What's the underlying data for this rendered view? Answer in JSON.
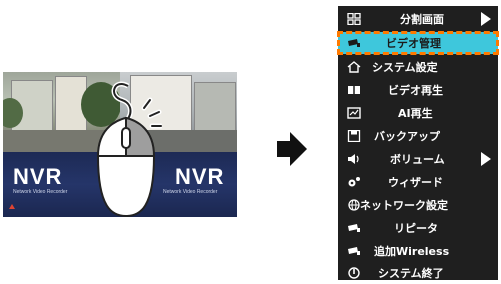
{
  "nvr_screen": {
    "logo_left": "NVR",
    "logo_right": "NVR",
    "subtitle_left": "Network Video Recorder",
    "subtitle_right": "Network Video Recorder"
  },
  "menu": {
    "items": [
      {
        "label": "分割画面",
        "icon": "grid-icon",
        "has_submenu": true
      },
      {
        "label": "ビデオ管理",
        "icon": "camera-icon",
        "selected": true
      },
      {
        "label": "システム設定",
        "icon": "home-icon"
      },
      {
        "label": "ビデオ再生",
        "icon": "playback-icon"
      },
      {
        "label": "AI再生",
        "icon": "ai-icon"
      },
      {
        "label": "バックアップ",
        "icon": "save-icon"
      },
      {
        "label": "ボリューム",
        "icon": "volume-icon",
        "has_submenu": true
      },
      {
        "label": "ウィザード",
        "icon": "wizard-icon"
      },
      {
        "label": "ネットワーク設定",
        "icon": "network-icon"
      },
      {
        "label": "リピータ",
        "icon": "repeater-icon"
      },
      {
        "label": "追加Wireless",
        "icon": "wireless-camera-icon"
      },
      {
        "label": "システム終了",
        "icon": "power-icon"
      }
    ],
    "colors": {
      "background": "#1f1f1f",
      "selected": "#3ec7dc",
      "selected_outline": "#ff7a00"
    }
  }
}
